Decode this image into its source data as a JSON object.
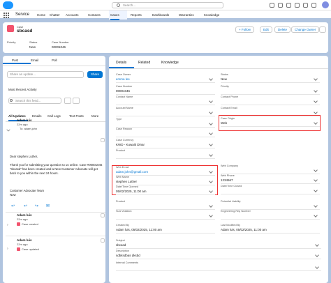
{
  "topbar": {
    "search_placeholder": "Search..."
  },
  "nav": {
    "app_name": "Service",
    "items": [
      "Home",
      "Chatter",
      "Accounts",
      "Contacts",
      "Cases",
      "Reports",
      "Dashboards",
      "Warranties",
      "Knowledge"
    ]
  },
  "header": {
    "object_label": "Case",
    "record_name": "sbcasd",
    "buttons": [
      "+ Follow",
      "Edit",
      "Delete",
      "Change Owner"
    ],
    "fields": [
      {
        "label": "Priority",
        "value": ""
      },
      {
        "label": "Status",
        "value": "New"
      },
      {
        "label": "Case Number",
        "value": "00001046"
      }
    ]
  },
  "left": {
    "tabs": [
      "Post",
      "Email",
      "Poll"
    ],
    "update_placeholder": "Share an update...",
    "share_label": "Share",
    "sort_label": "Most Recent Activity",
    "feed_search_placeholder": "Search this feed...",
    "feed_tabs": [
      "All Updates",
      "Emails",
      "Call Logs",
      "Text Posts",
      "More"
    ],
    "email_post": {
      "author": "Adam luis",
      "time": "22m ago",
      "to_line": "To: adam.john",
      "body": [
        "Dear stephen Luther,",
        "Thank you for submitting your question to us online. Case #00001046",
        "\"sbcasd\" has been created and a New Customer Advocate will get",
        "back to you within the next 24 hours.",
        "Customer Advocate Team",
        "Now"
      ]
    },
    "events": [
      {
        "author": "Adam luis",
        "time": "22m ago",
        "text": "Case created"
      },
      {
        "author": "Adam luis",
        "time": "22m ago",
        "text": "Case updated"
      }
    ]
  },
  "right": {
    "tabs": [
      "Details",
      "Related",
      "Knowledge"
    ],
    "left_fields": [
      {
        "label": "Case Owner",
        "value": "emma lee",
        "link": true
      },
      {
        "label": "Case Number",
        "value": "00001046"
      },
      {
        "label": "Contact Name",
        "value": ""
      },
      {
        "label": "Account Name",
        "value": ""
      },
      {
        "label": "Type",
        "value": ""
      },
      {
        "label": "Case Reason",
        "value": ""
      },
      {
        "label": "Case Currency",
        "value": "KWD - Kuwaiti Dinar"
      },
      {
        "label": "Product",
        "value": ""
      },
      {
        "label": "Web Email",
        "value": "adam.john@gmail.com",
        "link": true
      },
      {
        "label": "Web Name",
        "value": "stephen Luther"
      },
      {
        "label": "Date/Time Opened",
        "value": "05/02/2025, 11:00 am"
      },
      {
        "label": "Product",
        "value": ""
      },
      {
        "label": "SLA Violation",
        "value": ""
      },
      {
        "label": "Created By",
        "value": "Adam luis, 05/02/2025, 11:00 am"
      }
    ],
    "right_fields": [
      {
        "label": "Status",
        "value": "New"
      },
      {
        "label": "Priority",
        "value": ""
      },
      {
        "label": "Contact Phone",
        "value": ""
      },
      {
        "label": "Contact Email",
        "value": ""
      },
      {
        "label": "Case Origin",
        "value": "Web"
      },
      {
        "label": "Web Company",
        "value": ""
      },
      {
        "label": "Web Phone",
        "value": "1234567"
      },
      {
        "label": "Date/Time Closed",
        "value": ""
      },
      {
        "label": "Potential Liability",
        "value": ""
      },
      {
        "label": "Engineering Req Number",
        "value": ""
      },
      {
        "label": "Last Modified By",
        "value": "Adam luis, 05/02/2025, 11:00 am"
      }
    ],
    "wide_fields": [
      {
        "label": "Subject",
        "value": "sbcasd"
      },
      {
        "label": "Description",
        "value": "sdbksdbas dksbd"
      },
      {
        "label": "Internal Comments",
        "value": ""
      }
    ]
  },
  "colors": {
    "brand": "#0176d3",
    "case_icon": "#f2536d",
    "highlight": "#e33333",
    "background": "#b0c4df"
  }
}
